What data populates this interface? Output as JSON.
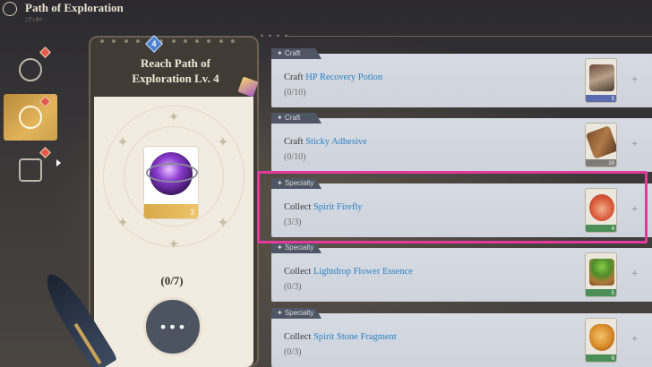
{
  "app": {
    "title": "Path of Exploration",
    "subtitle": "ﾆｱﾝｶﾊ"
  },
  "nav": {
    "items": [
      {
        "icon": "globe-icon",
        "badge": true,
        "active": false
      },
      {
        "icon": "exploration-icon",
        "badge": true,
        "active": true
      },
      {
        "icon": "bag-icon",
        "badge": true,
        "active": false
      }
    ]
  },
  "card": {
    "level_badge": "4",
    "title_line1": "Reach Path of",
    "title_line2": "Exploration Lv. 4",
    "reward_count": "3",
    "progress": "(0/7)",
    "more_label": "•••"
  },
  "ornament": "✦ ✦ ✦ ✦",
  "tasks": [
    {
      "category": "✦ Craft",
      "verb": "Craft",
      "item": "HP Recovery Potion",
      "progress": "(0/10)",
      "item_count": "5",
      "item_color": "#5b6bb0",
      "art": "potion"
    },
    {
      "category": "✦ Craft",
      "verb": "Craft",
      "item": "Sticky Adhesive",
      "progress": "(0/10)",
      "item_count": "10",
      "item_color": "#7f7c78",
      "art": "wood"
    },
    {
      "category": "✦ Specialty",
      "verb": "Collect",
      "item": "Spirit Firefly",
      "progress": "(3/3)",
      "item_count": "4",
      "item_color": "#4c8e57",
      "art": "firefly"
    },
    {
      "category": "✦ Specialty",
      "verb": "Collect",
      "item": "Lightdrop Flower Essence",
      "progress": "(0/3)",
      "item_count": "5",
      "item_color": "#4c8e57",
      "art": "essence"
    },
    {
      "category": "✦ Specialty",
      "verb": "Collect",
      "item": "Spirit Stone Fragment",
      "progress": "(0/3)",
      "item_count": "6",
      "item_color": "#4c8e57",
      "art": "stone"
    }
  ],
  "colors": {
    "highlight": "#e23a9c",
    "item_link": "#2a82c4",
    "active_nav": "#e3b45a"
  }
}
